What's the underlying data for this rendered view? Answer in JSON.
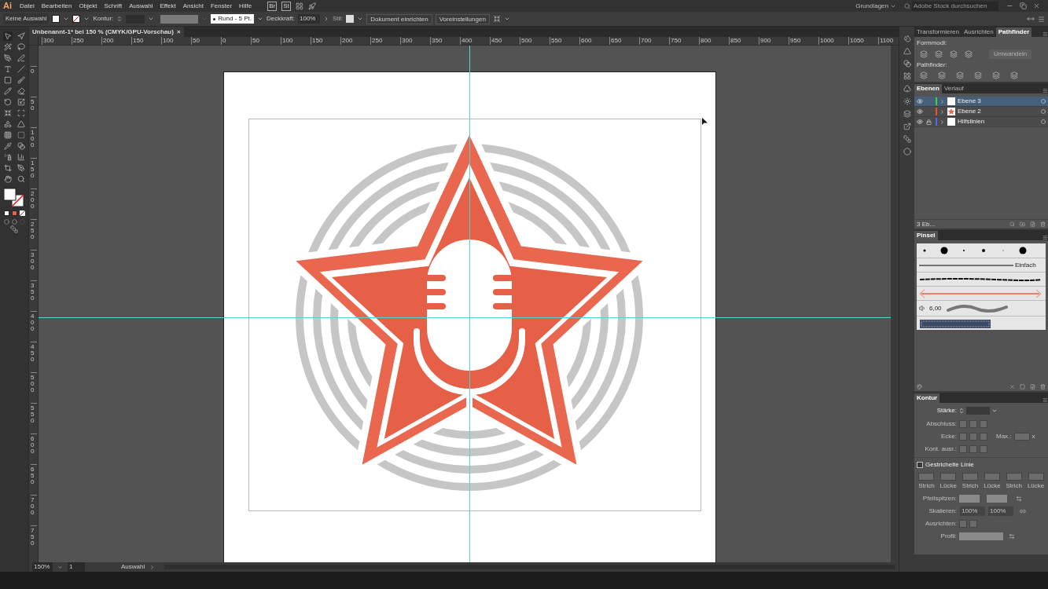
{
  "menu_bar": {
    "app_logo": "Ai",
    "items": [
      "Datei",
      "Bearbeiten",
      "Objekt",
      "Schrift",
      "Auswahl",
      "Effekt",
      "Ansicht",
      "Fenster",
      "Hilfe"
    ],
    "bridge": "Br",
    "stock": "St",
    "workspace": "Grundlagen",
    "search": {
      "placeholder": "Adobe Stock durchsuchen"
    }
  },
  "control_bar": {
    "selection": "Keine Auswahl",
    "stroke_label": "Kontur:",
    "brush": "Rund - 5 Pt.",
    "opacity_label": "Deckkraft:",
    "opacity": "100%",
    "style_label": "Stil:",
    "buttons": [
      "Dokument einrichten",
      "Voreinstellungen"
    ]
  },
  "document_tab": {
    "title": "Unbenannt-1* bei 150 % (CMYK/GPU-Vorschau)",
    "close": "×"
  },
  "rulers": {
    "horizontal": [
      "300",
      "250",
      "200",
      "150",
      "100",
      "50",
      "0",
      "50",
      "100",
      "150",
      "200",
      "250",
      "300",
      "350",
      "400",
      "450",
      "500",
      "550",
      "600",
      "650",
      "700",
      "750",
      "800",
      "850",
      "900",
      "950",
      "1000",
      "1050",
      "1100"
    ],
    "vertical": [
      "0",
      "50",
      "100",
      "150",
      "200",
      "250",
      "300",
      "350",
      "400",
      "450",
      "500",
      "550",
      "600",
      "650",
      "700",
      "750"
    ]
  },
  "pathfinder_panel": {
    "tabs": [
      {
        "label": "Transformieren",
        "selected": false
      },
      {
        "label": "Ausrichten",
        "selected": false
      },
      {
        "label": "Pathfinder",
        "selected": true
      }
    ],
    "shape_modes_label": "Formmodi:",
    "expand_button": {
      "label": "Umwandeln",
      "disabled": true
    },
    "pathfinders_label": "Pathfinder:"
  },
  "layers_panel": {
    "tabs": [
      {
        "label": "Ebenen",
        "selected": true
      },
      {
        "label": "Verlauf",
        "selected": false
      }
    ],
    "layers": [
      {
        "name": "Ebene 3",
        "color": "#3fd13f",
        "selected": true,
        "visible": true,
        "locked": false,
        "thumbnail_has_star": false
      },
      {
        "name": "Ebene 2",
        "color": "#e8503a",
        "selected": false,
        "visible": true,
        "locked": false,
        "thumbnail_has_star": true
      },
      {
        "name": "Hilfslinien",
        "color": "#4a6cf0",
        "selected": false,
        "visible": true,
        "locked": true,
        "thumbnail_has_star": false
      }
    ],
    "footer": "3 Eb..."
  },
  "brushes_panel": {
    "title": "Pinsel",
    "basic_label": "Einfach",
    "bristle_size": "6,00"
  },
  "stroke_panel": {
    "title": "Kontur",
    "weight_label": "Stärke:",
    "options_disabled": true,
    "cap_label": "Abschluss:",
    "corner_label": "Ecke:",
    "limit_label": "Max.:",
    "limit_unit": "x",
    "align_label": "Kont. ausr.:",
    "dashed": {
      "label": "Gestrichelte Linie",
      "checked": false,
      "slots": [
        "Strich",
        "Lücke",
        "Strich",
        "Lücke",
        "Strich",
        "Lücke"
      ]
    },
    "arrowheads_label": "Pfeilspitzen:",
    "scale_label": "Skalieren:",
    "scale_values": [
      "100%",
      "100%"
    ],
    "arrow_align_label": "Ausrichten:",
    "profile_label": "Profil:"
  },
  "status_bar": {
    "zoom": "150%",
    "page": "1",
    "tool": "Auswahl"
  }
}
